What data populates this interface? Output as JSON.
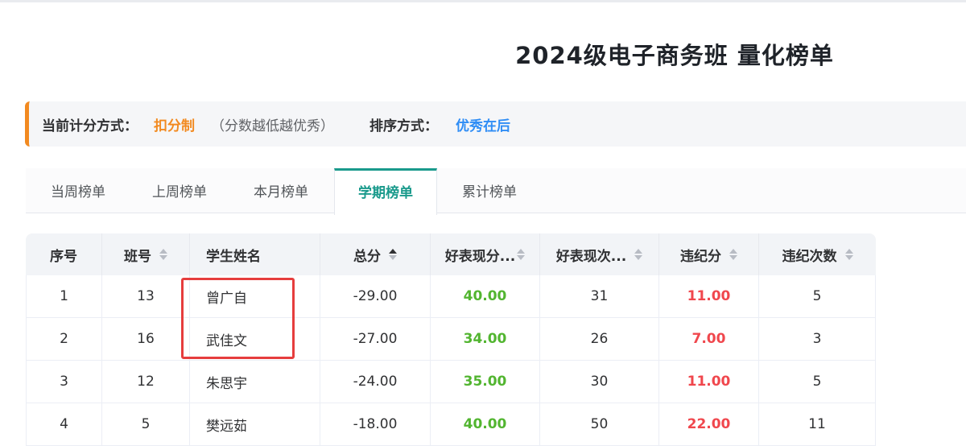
{
  "page": {
    "title": "2024级电子商务班 量化榜单"
  },
  "info": {
    "scoring_label": "当前计分方式：",
    "scoring_value": "扣分制",
    "scoring_hint": "（分数越低越优秀）",
    "sort_label": "排序方式：",
    "sort_value": "优秀在后"
  },
  "tabs": [
    {
      "label": "当周榜单",
      "active": false
    },
    {
      "label": "上周榜单",
      "active": false
    },
    {
      "label": "本月榜单",
      "active": false
    },
    {
      "label": "学期榜单",
      "active": true
    },
    {
      "label": "累计榜单",
      "active": false
    }
  ],
  "table": {
    "columns": [
      "序号",
      "班号",
      "学生姓名",
      "总分",
      "好表现分...",
      "好表现次...",
      "违纪分",
      "违纪次数"
    ],
    "rows": [
      {
        "index": "1",
        "class_no": "13",
        "name": "曾广自",
        "total": "-29.00",
        "good_score": "40.00",
        "good_count": "31",
        "penalty_score": "11.00",
        "penalty_count": "5"
      },
      {
        "index": "2",
        "class_no": "16",
        "name": "武佳文",
        "total": "-27.00",
        "good_score": "34.00",
        "good_count": "26",
        "penalty_score": "7.00",
        "penalty_count": "3"
      },
      {
        "index": "3",
        "class_no": "12",
        "name": "朱思宇",
        "total": "-24.00",
        "good_score": "35.00",
        "good_count": "30",
        "penalty_score": "11.00",
        "penalty_count": "5"
      },
      {
        "index": "4",
        "class_no": "5",
        "name": "樊远茹",
        "total": "-18.00",
        "good_score": "40.00",
        "good_count": "50",
        "penalty_score": "22.00",
        "penalty_count": "11"
      }
    ]
  },
  "colors": {
    "accent_teal": "#1a9a8c",
    "accent_orange": "#f28a20",
    "accent_blue": "#2f8df5",
    "good_green": "#52b530",
    "penalty_red": "#f0474d",
    "highlight_box": "#e63d3d"
  }
}
